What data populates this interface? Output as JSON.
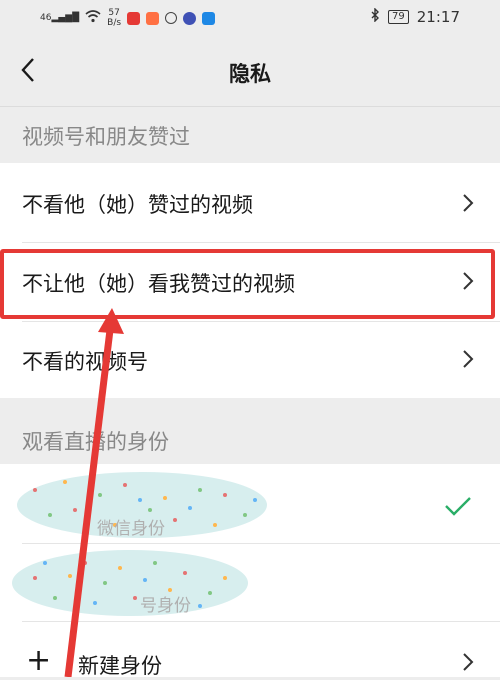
{
  "status_bar": {
    "network": "46",
    "speed_value": "57",
    "speed_unit": "B/s",
    "battery": "79",
    "time": "21:17",
    "app_icon_colors": [
      "#e53935",
      "#ff7043",
      "#444444",
      "#3f51b5",
      "#1e88e5"
    ]
  },
  "nav": {
    "back_icon": "chevron-left-icon",
    "title": "隐私"
  },
  "sections": {
    "likes_header": "视频号和朋友赞过",
    "live_header": "观看直播的身份"
  },
  "rows": {
    "hide_their_likes": "不看他（她）赞过的视频",
    "hide_my_likes": "不让他（她）看我赞过的视频",
    "hidden_channels": "不看的视频号"
  },
  "identities": {
    "wechat_identity": "微信身份",
    "channel_identity": "号身份",
    "new_identity": "新建身份"
  },
  "colors": {
    "background": "#ededed",
    "check": "#2aae67",
    "highlight": "#e53935",
    "arrow": "#e53935"
  }
}
